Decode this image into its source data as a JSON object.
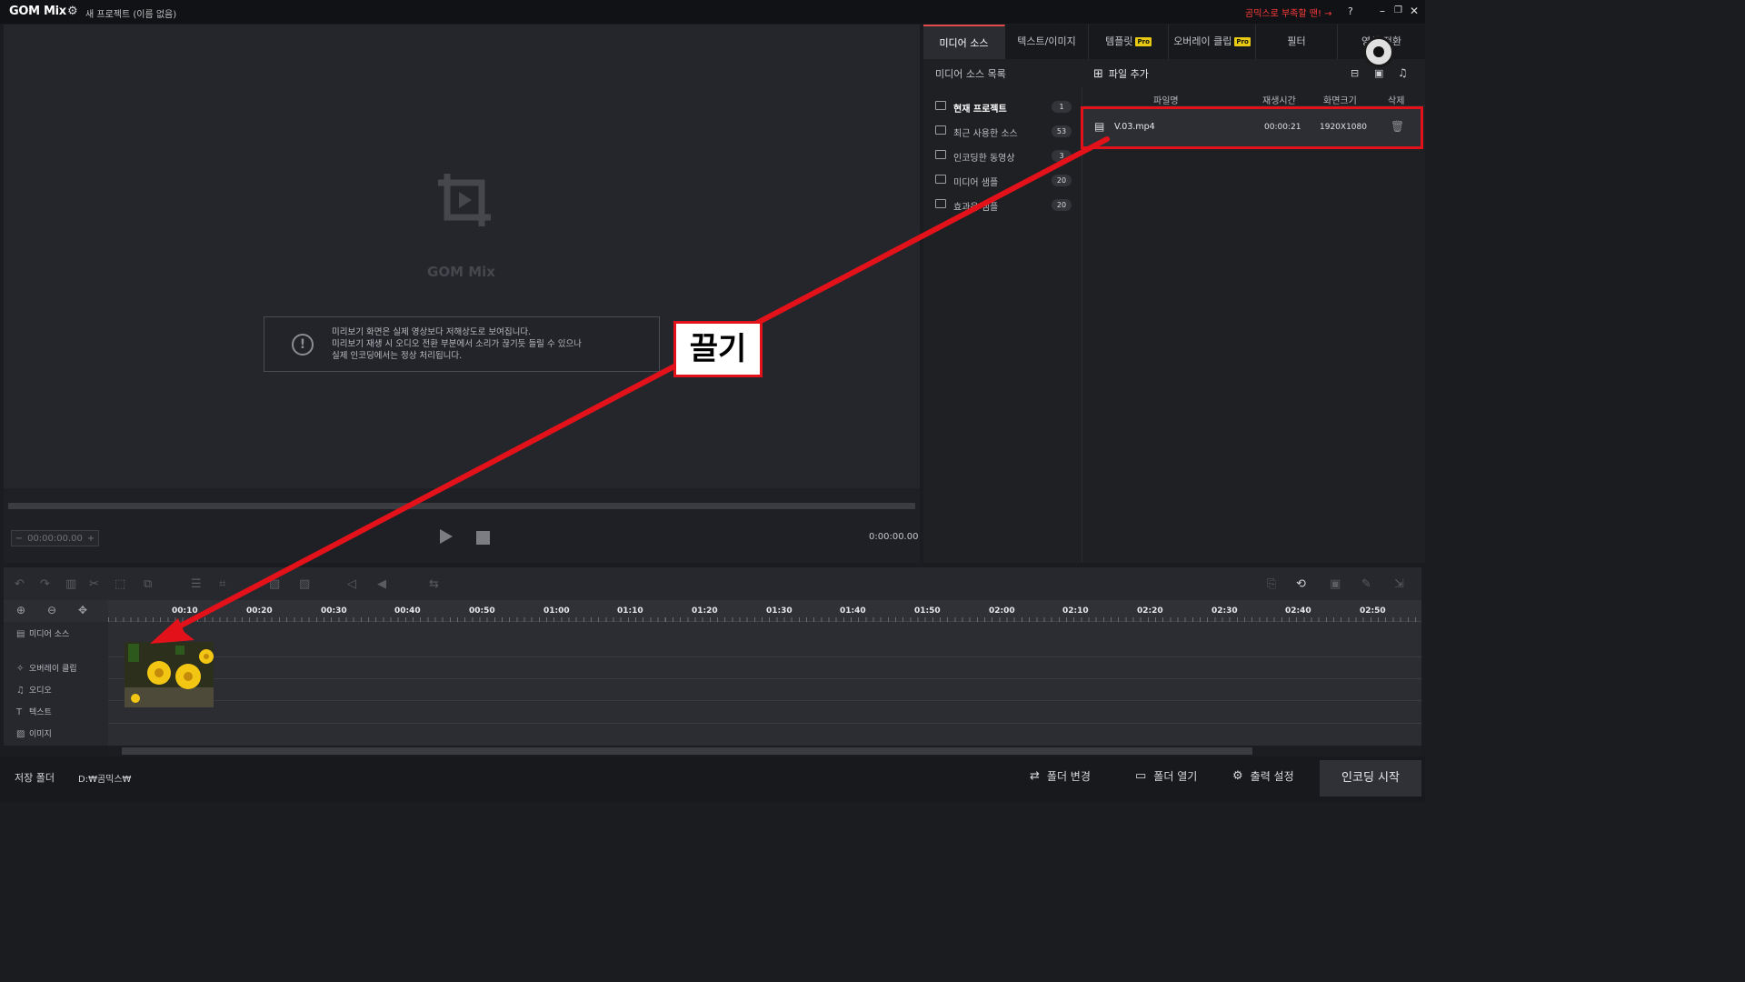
{
  "titlebar": {
    "logo": "GOM Mix",
    "project": "새 프로젝트 (이름 없음)",
    "promo": "곰믹스로 부족할 땐! →",
    "help": "?"
  },
  "preview": {
    "logo_text": "GOM Mix",
    "notice_lines": [
      "미리보기 화면은 실제 영상보다 저해상도로 보여집니다.",
      "미리보기 재생 시 오디오 전환 부분에서 소리가 끊기듯 들릴 수 있으나",
      "실제 인코딩에서는 정상 처리됩니다."
    ],
    "timecode": "00:00:00.00",
    "duration": "0:00:00.00"
  },
  "tabs": [
    {
      "label": "미디어 소스",
      "pro": false
    },
    {
      "label": "텍스트/이미지",
      "pro": false
    },
    {
      "label": "템플릿",
      "pro": true
    },
    {
      "label": "오버레이 클립",
      "pro": true
    },
    {
      "label": "필터",
      "pro": false
    },
    {
      "label": "영상 전환",
      "pro": false
    }
  ],
  "pro_badge": "Pro",
  "sources": {
    "title": "미디어 소스 목록",
    "items": [
      {
        "label": "현재 프로젝트",
        "count": "1"
      },
      {
        "label": "최근 사용한 소스",
        "count": "53"
      },
      {
        "label": "인코딩한 동영상",
        "count": "3"
      },
      {
        "label": "미디어 샘플",
        "count": "20"
      },
      {
        "label": "효과음 샘플",
        "count": "20"
      }
    ]
  },
  "files": {
    "add_label": "파일 추가",
    "columns": [
      "파일명",
      "재생시간",
      "화면크기",
      "삭제"
    ],
    "rows": [
      {
        "name": "V.03.mp4",
        "duration": "00:00:21",
        "size": "1920X1080"
      }
    ]
  },
  "timeline": {
    "ticks": [
      "00:10",
      "00:20",
      "00:30",
      "00:40",
      "00:50",
      "01:00",
      "01:10",
      "01:20",
      "01:30",
      "01:40",
      "01:50",
      "02:00",
      "02:10",
      "02:20",
      "02:30",
      "02:40",
      "02:50"
    ],
    "tracks": [
      "미디어 소스",
      "오버레이 클립",
      "오디오",
      "텍스트",
      "이미지"
    ]
  },
  "bottom": {
    "save_label": "저장 폴더",
    "save_path": "D:₩곰믹스₩",
    "change_folder": "폴더 변경",
    "open_folder": "폴더 열기",
    "output_settings": "출력 설정",
    "encode": "인코딩 시작"
  },
  "annotation": {
    "label": "끌기",
    "color": "#e3121a"
  }
}
